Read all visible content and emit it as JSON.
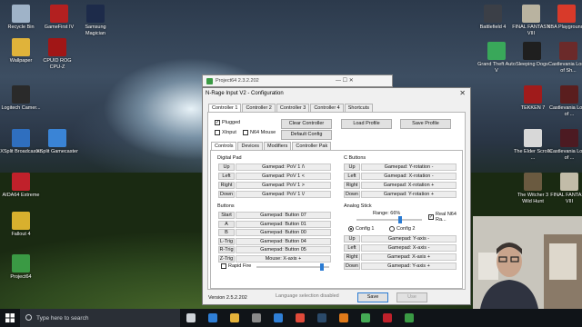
{
  "desktop": {
    "icons": [
      {
        "label": "Recycle Bin",
        "color": "#9fb3c8"
      },
      {
        "label": "GameFirst IV",
        "color": "#b32020"
      },
      {
        "label": "Samsung Magician",
        "color": "#1d2b4a"
      },
      {
        "label": "Wallpaper",
        "color": "#e0b33a"
      },
      {
        "label": "CPUID ROG CPU-Z",
        "color": "#a11616"
      },
      {
        "label": "Logitech Camer...",
        "color": "#2a2a2a"
      },
      {
        "label": "XSplit Broadcaster",
        "color": "#2f6fbf"
      },
      {
        "label": "XSplit Gamecaster",
        "color": "#3a84d6"
      },
      {
        "label": "AIDA64 Extreme",
        "color": "#c0212b"
      },
      {
        "label": "Fallout 4",
        "color": "#d8b02e"
      },
      {
        "label": "Project64",
        "color": "#3a9a44"
      },
      {
        "label": "Battlefield 4",
        "color": "#3b3f47"
      },
      {
        "label": "FINAL FANTASY VIII",
        "color": "#b9b3a0"
      },
      {
        "label": "NBA Playgrounds",
        "color": "#d83a2a"
      },
      {
        "label": "Grand Theft Auto V",
        "color": "#39a85a"
      },
      {
        "label": "Sleeping Dogs",
        "color": "#1f1f1f"
      },
      {
        "label": "Castlevania Lords of Sh...",
        "color": "#6b2a2a"
      },
      {
        "label": "TEKKEN 7",
        "color": "#a01b1b"
      },
      {
        "label": "Castlevania Lords of ...",
        "color": "#5a1e1e"
      },
      {
        "label": "The Elder Scrolls ...",
        "color": "#d8d8d8"
      },
      {
        "label": "Castlevania Lords of ...",
        "color": "#4c1a22"
      },
      {
        "label": "The Witcher 3 Wild Hunt",
        "color": "#6a5a40"
      },
      {
        "label": "FINAL FANTASY VIII",
        "color": "#c2bca8"
      }
    ]
  },
  "taskbar": {
    "search_placeholder": "Type here to search",
    "apps": [
      {
        "name": "task-view",
        "color": "#cfd3d8"
      },
      {
        "name": "edge",
        "color": "#2f7fd6"
      },
      {
        "name": "file-explorer",
        "color": "#e5b33a"
      },
      {
        "name": "store",
        "color": "#8a8a8a"
      },
      {
        "name": "mail",
        "color": "#2f7fd6"
      },
      {
        "name": "chrome",
        "color": "#e04a3a"
      },
      {
        "name": "steam",
        "color": "#2b4a6a"
      },
      {
        "name": "app-orange",
        "color": "#e07a1a"
      },
      {
        "name": "app-green",
        "color": "#44aa55"
      },
      {
        "name": "app-red",
        "color": "#c0212b"
      },
      {
        "name": "project64",
        "color": "#3a9a44"
      }
    ]
  },
  "p64_window": {
    "title": "Project64 2.3.2.202",
    "controls": "—  ☐  ✕"
  },
  "dialog": {
    "title": "N-Rage Input V2 - Configuration",
    "close": "✕",
    "controller_tabs": [
      "Controller 1",
      "Controller 2",
      "Controller 3",
      "Controller 4",
      "Shortcuts"
    ],
    "plugged": "Plugged",
    "xinput": "XInput",
    "n64mouse": "N64 Mouse",
    "clear_controller": "Clear Controller",
    "default_config": "Default Config",
    "load_profile": "Load Profile",
    "save_profile": "Save Profile",
    "sub_tabs": [
      "Controls",
      "Devices",
      "Modifiers",
      "Controller Pak"
    ],
    "digital_pad": {
      "title": "Digital Pad",
      "rows": [
        {
          "k": "Up",
          "v": "Gamepad: PoV 1 /\\"
        },
        {
          "k": "Left",
          "v": "Gamepad: PoV 1 <"
        },
        {
          "k": "Right",
          "v": "Gamepad: PoV 1 >"
        },
        {
          "k": "Down",
          "v": "Gamepad: PoV 1 \\/"
        }
      ]
    },
    "c_buttons": {
      "title": "C Buttons",
      "rows": [
        {
          "k": "Up",
          "v": "Gamepad: Y-rotation -"
        },
        {
          "k": "Left",
          "v": "Gamepad: X-rotation -"
        },
        {
          "k": "Right",
          "v": "Gamepad: X-rotation +"
        },
        {
          "k": "Down",
          "v": "Gamepad: Y-rotation +"
        }
      ]
    },
    "buttons": {
      "title": "Buttons",
      "rows": [
        {
          "k": "Start",
          "v": "Gamepad: Button 07"
        },
        {
          "k": "A",
          "v": "Gamepad: Button 01"
        },
        {
          "k": "B",
          "v": "Gamepad: Button 00"
        },
        {
          "k": "L-Trig",
          "v": "Gamepad: Button 04"
        },
        {
          "k": "R-Trig",
          "v": "Gamepad: Button 05"
        },
        {
          "k": "Z-Trig",
          "v": "Mouse: X-axis +"
        }
      ]
    },
    "rapid_fire": "Rapid Fire",
    "rapid_fire_level": 0.9,
    "analog_stick": {
      "title": "Analog Stick",
      "range_label": "Range: 66%",
      "range_value": 66,
      "real_n64": "Real N64 Ra...",
      "config1": "Config 1",
      "config2": "Config 2",
      "rows": [
        {
          "k": "Up",
          "v": "Gamepad: Y-axis -"
        },
        {
          "k": "Left",
          "v": "Gamepad: X-axis -"
        },
        {
          "k": "Right",
          "v": "Gamepad: X-axis +"
        },
        {
          "k": "Down",
          "v": "Gamepad: Y-axis +"
        }
      ]
    },
    "version": "Version 2.5.2.202",
    "language_disabled": "Language selection disabled",
    "save": "Save",
    "use": "Use"
  }
}
